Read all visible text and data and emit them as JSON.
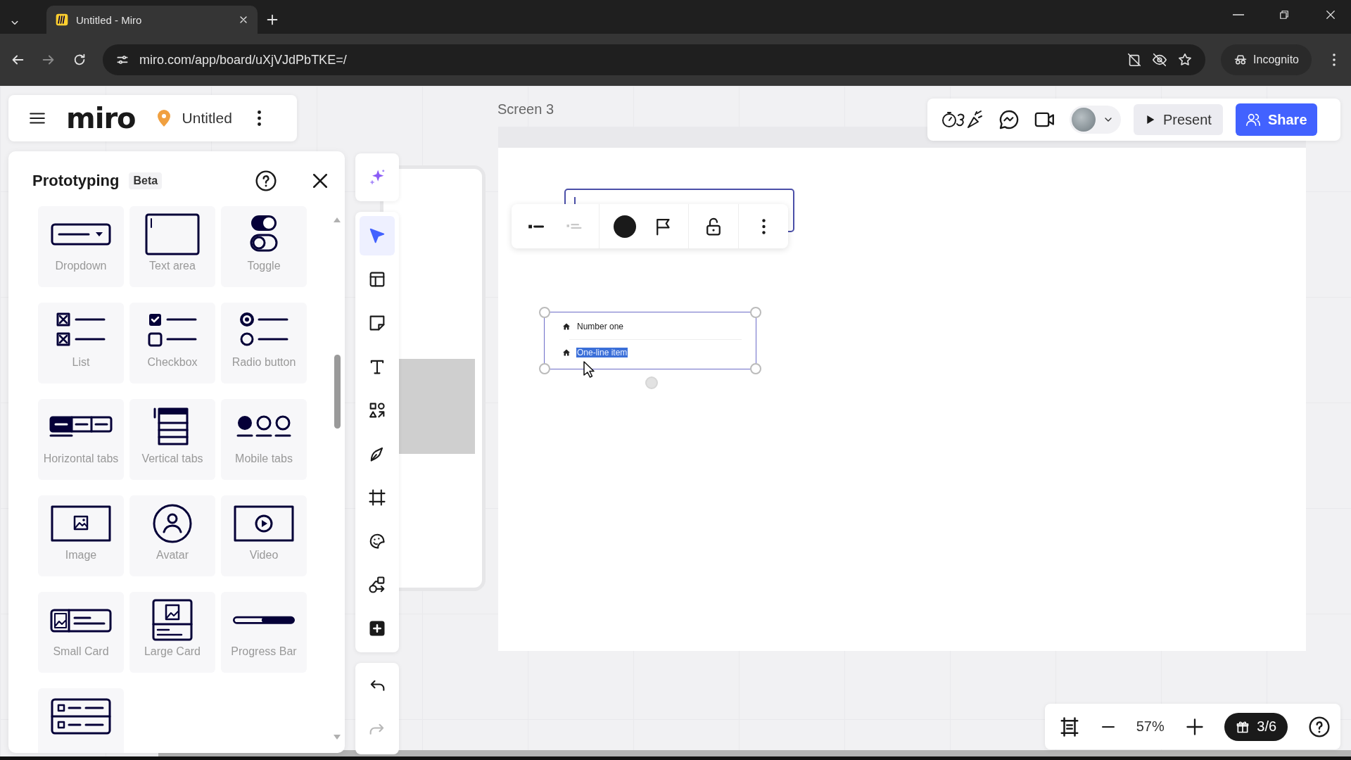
{
  "browser": {
    "tab_title": "Untitled - Miro",
    "url": "miro.com/app/board/uXjVJdPbTKE=/",
    "profile": "Incognito"
  },
  "board_header": {
    "logo": "miro",
    "title": "Untitled"
  },
  "prototyping_panel": {
    "title": "Prototyping",
    "badge": "Beta",
    "components": [
      {
        "kind": "dropdown",
        "label": "Dropdown"
      },
      {
        "kind": "textarea",
        "label": "Text area"
      },
      {
        "kind": "toggle",
        "label": "Toggle"
      },
      {
        "kind": "list",
        "label": "List"
      },
      {
        "kind": "checkbox",
        "label": "Checkbox"
      },
      {
        "kind": "radio",
        "label": "Radio button"
      },
      {
        "kind": "htabs",
        "label": "Horizontal tabs"
      },
      {
        "kind": "vtabs",
        "label": "Vertical tabs"
      },
      {
        "kind": "mtabs",
        "label": "Mobile tabs"
      },
      {
        "kind": "image",
        "label": "Image"
      },
      {
        "kind": "avatar",
        "label": "Avatar"
      },
      {
        "kind": "video",
        "label": "Video"
      },
      {
        "kind": "smallcard",
        "label": "Small Card"
      },
      {
        "kind": "largecard",
        "label": "Large Card"
      },
      {
        "kind": "progress",
        "label": "Progress Bar"
      },
      {
        "kind": "listcard"
      }
    ]
  },
  "toolbar": {
    "tools": [
      {
        "kind": "ai",
        "selected": false
      },
      {
        "kind": "select",
        "selected": true
      },
      {
        "kind": "templates",
        "selected": false
      },
      {
        "kind": "sticky",
        "selected": false
      },
      {
        "kind": "text",
        "selected": false
      },
      {
        "kind": "shapes",
        "selected": false
      },
      {
        "kind": "pen",
        "selected": false
      },
      {
        "kind": "frame",
        "selected": false
      },
      {
        "kind": "stickers",
        "selected": false
      },
      {
        "kind": "diagram",
        "selected": false
      },
      {
        "kind": "more",
        "selected": false
      }
    ],
    "history": [
      {
        "kind": "undo",
        "disabled": false
      },
      {
        "kind": "redo",
        "disabled": true
      }
    ]
  },
  "canvas": {
    "frame_label": "Screen 3",
    "context_toolbar": [
      {
        "kind": "bullet",
        "disabled": false
      },
      {
        "kind": "lines",
        "disabled": true
      },
      {
        "kind": "color",
        "color": "#1a1a1a"
      },
      {
        "kind": "flag"
      },
      {
        "kind": "lock"
      },
      {
        "kind": "more"
      }
    ],
    "list_widget": {
      "items": [
        {
          "text": "Number one",
          "selected": false
        },
        {
          "text": "One-line item",
          "selected": true
        }
      ]
    }
  },
  "top_actions": {
    "present": "Present",
    "share": "Share"
  },
  "zoom_bar": {
    "zoom": "57%",
    "gift_count": "3/6"
  }
}
